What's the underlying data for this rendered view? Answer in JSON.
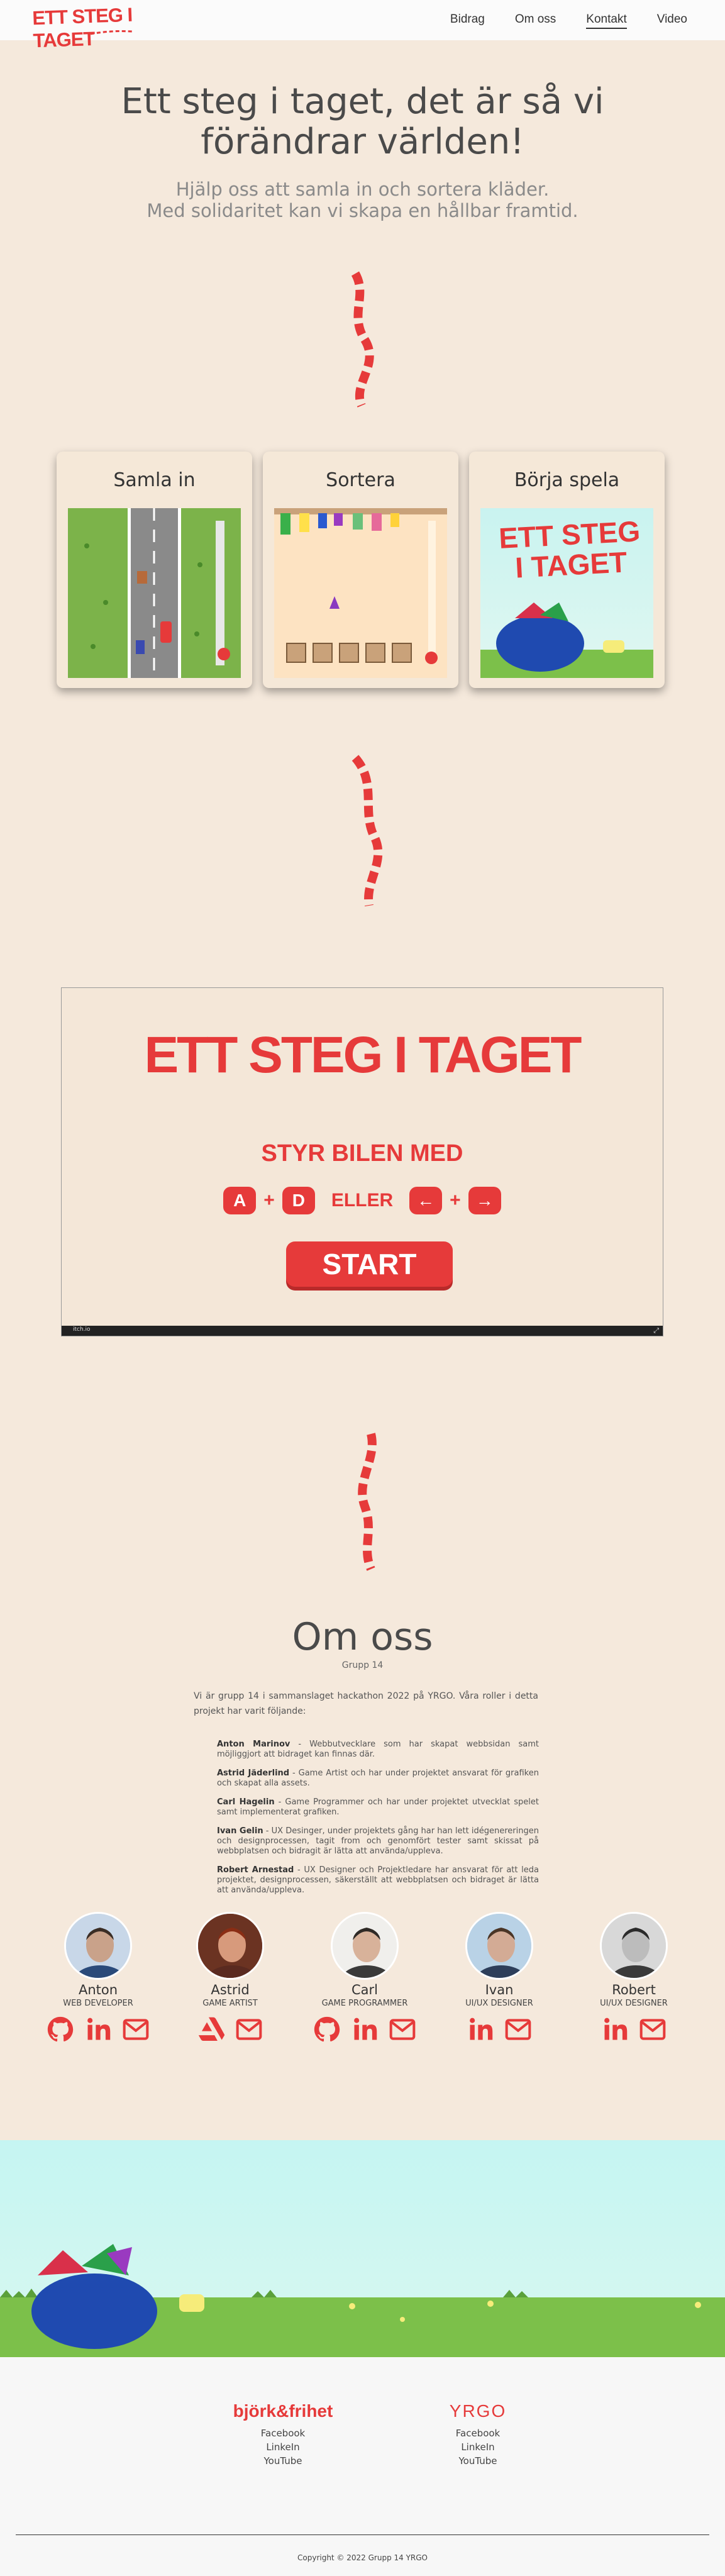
{
  "header": {
    "logo_text": "ETT STEG I TAGET",
    "nav": [
      "Bidrag",
      "Om oss",
      "Kontakt",
      "Video"
    ],
    "active_nav": "Kontakt"
  },
  "hero": {
    "title_line1": "Ett steg i taget, det är så vi",
    "title_line2": "förändrar världen!",
    "sub_line1": "Hjälp oss att samla in och sortera kläder.",
    "sub_line2": "Med solidaritet kan vi skapa en hållbar framtid."
  },
  "cards": [
    {
      "title": "Samla in"
    },
    {
      "title": "Sortera"
    },
    {
      "title": "Börja spela"
    }
  ],
  "card3_logo_line1": "ETT STEG",
  "card3_logo_line2": "I TAGET",
  "game": {
    "title": "ETT STEG I TAGET",
    "steer_text": "STYR BILEN MED",
    "key_a": "A",
    "key_d": "D",
    "or_text": "ELLER",
    "key_left": "←",
    "key_right": "→",
    "start_label": "START",
    "bar_label": "itch.io"
  },
  "about": {
    "title": "Om oss",
    "subtitle": "Grupp 14",
    "intro": "Vi är grupp 14 i sammanslaget hackathon 2022 på YRGO. Våra roller i detta projekt har varit följande:",
    "roles": [
      {
        "name": "Anton Marinov",
        "text": " - Webbutvecklare som har skapat webbsidan samt möjliggjort att bidraget kan finnas där."
      },
      {
        "name": "Astrid Jäderlind",
        "text": " - Game Artist och har under projektet ansvarat för grafiken och skapat alla assets."
      },
      {
        "name": "Carl Hagelin",
        "text": " - Game Programmer och har under projektet utvecklat spelet samt implementerat grafiken."
      },
      {
        "name": "Ivan Gelin",
        "text": " - UX Desinger, under projektets gång har han lett idégenereringen och designprocessen, tagit from och genomfört tester samt skissat på webbplatsen och bidragit är lätta att använda/upplevа."
      },
      {
        "name": "Robert Arnestad",
        "text": " - UX Designer och Projektledare har ansvarat för att leda projektet, designprocessen, säkerställt att webbplatsen och bidraget är lätta att använda/upplevа."
      }
    ]
  },
  "team": [
    {
      "name": "Anton",
      "role": "WEB DEVELOPER",
      "icons": [
        "github-icon",
        "linkedin-icon",
        "mail-icon"
      ],
      "skin": "#c9a28a",
      "hair": "#3a2d25",
      "shirt": "#2a4a7a",
      "bg": "#c8d7e8"
    },
    {
      "name": "Astrid",
      "role": "GAME ARTIST",
      "icons": [
        "artstation-icon",
        "mail-icon"
      ],
      "skin": "#d79a7c",
      "hair": "#8a2d14",
      "shirt": "#5a2a20",
      "bg": "#6b3322"
    },
    {
      "name": "Carl",
      "role": "GAME PROGRAMMER",
      "icons": [
        "github-icon",
        "linkedin-icon",
        "mail-icon"
      ],
      "skin": "#d8b29a",
      "hair": "#2f2a26",
      "shirt": "#3a3a3a",
      "bg": "#f0efec"
    },
    {
      "name": "Ivan",
      "role": "UI/UX DESIGNER",
      "icons": [
        "linkedin-icon",
        "mail-icon"
      ],
      "skin": "#d3ab95",
      "hair": "#4a3526",
      "shirt": "#2d3e5a",
      "bg": "#b9d2e6"
    },
    {
      "name": "Robert",
      "role": "UI/UX DESIGNER",
      "icons": [
        "linkedin-icon",
        "mail-icon"
      ],
      "skin": "#bcbcbc",
      "hair": "#2b2b2b",
      "shirt": "#3a3a3a",
      "bg": "#d8d8d8"
    }
  ],
  "footer": {
    "brand1": "björk&frihet",
    "brand2": "YRGO",
    "col1_links": [
      "Facebook",
      "LinkeIn",
      "YouTube"
    ],
    "col2_links": [
      "Facebook",
      "LinkeIn",
      "YouTube"
    ],
    "copyright": "Copyright © 2022 Grupp 14 YRGO"
  },
  "colors": {
    "accent": "#e63a3a",
    "page_bg": "#f5e9dc",
    "card_bg": "#f5e8d8"
  }
}
